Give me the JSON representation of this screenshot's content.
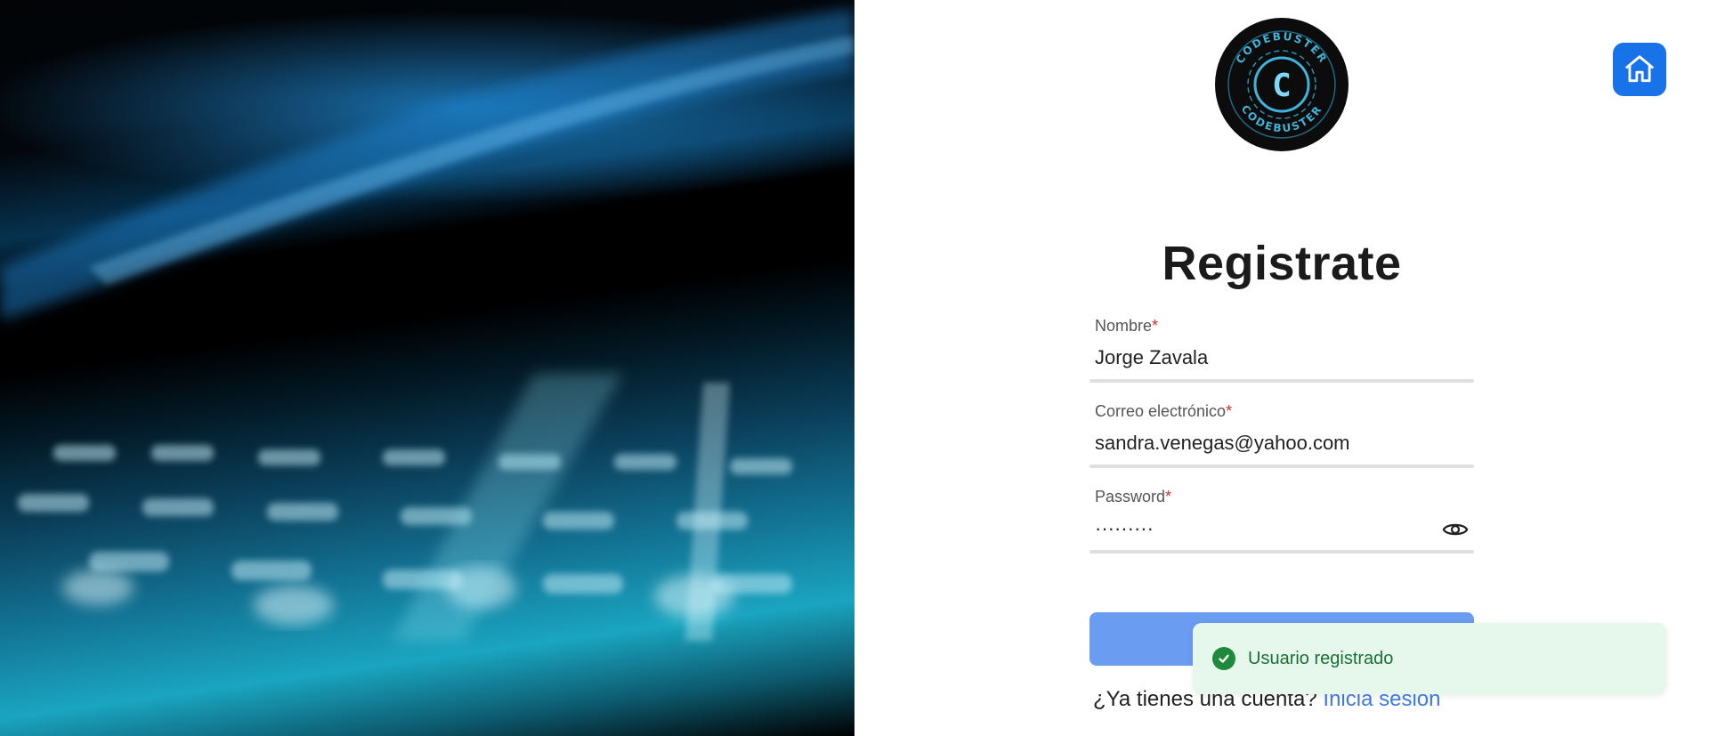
{
  "hero": {
    "alt": "laptop keyboard with blue light"
  },
  "logo": {
    "text_top": "CODEBUSTER",
    "text_bottom": "CODEBUSTER",
    "letter": "C"
  },
  "home_button": {
    "icon": "home-icon"
  },
  "form": {
    "title": "Registrate",
    "fields": [
      {
        "label": "Nombre",
        "required_mark": "*",
        "value": "Jorge Zavala"
      },
      {
        "label": "Correo electrónico",
        "required_mark": "*",
        "value": "sandra.venegas@yahoo.com"
      },
      {
        "label": "Password",
        "required_mark": "*",
        "value": "·········",
        "icon": "eye-icon"
      }
    ],
    "submit_label": "",
    "login_prompt": "¿Ya tienes una cuenta?",
    "login_link": "Inicia sesión"
  },
  "toast": {
    "message": "Usuario registrado",
    "icon": "check-circle-icon"
  },
  "colors": {
    "accent": "#1873e8",
    "submit": "#6a9cf2",
    "link": "#3f7be6",
    "toast_bg": "#e6f7ec",
    "toast_text": "#1b6f34",
    "required": "#d32f2f"
  }
}
